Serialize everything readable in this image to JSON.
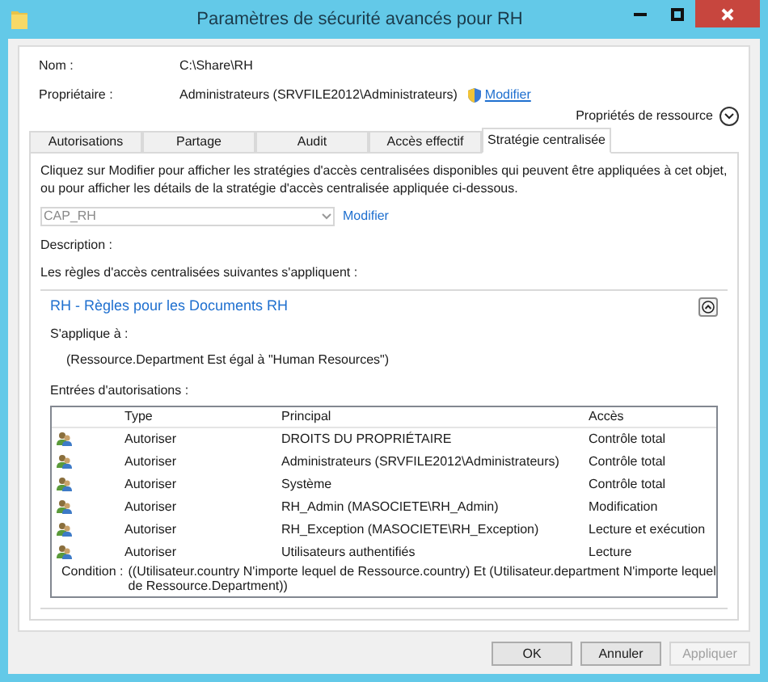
{
  "window": {
    "title": "Paramètres de sécurité avancés pour RH"
  },
  "fields": [
    {
      "label": "Nom :",
      "value": "C:\\Share\\RH"
    },
    {
      "label": "Propriétaire :",
      "value": "Administrateurs (SRVFILE2012\\Administrateurs)",
      "link": "Modifier"
    }
  ],
  "resource_properties": {
    "label": "Propriétés de ressource",
    "expanded": false
  },
  "tabs": [
    {
      "label": "Autorisations",
      "selected": false
    },
    {
      "label": "Partage",
      "selected": false
    },
    {
      "label": "Audit",
      "selected": false
    },
    {
      "label": "Accès effectif",
      "selected": false
    },
    {
      "label": "Stratégie centralisée",
      "selected": true
    }
  ],
  "intro": "Cliquez sur Modifier pour afficher les stratégies d'accès centralisées disponibles qui peuvent être appliquées à cet objet, ou pour afficher les détails de la stratégie d'accès centralisée appliquée ci-dessous.",
  "policy_select": {
    "value": "CAP_RH",
    "disabled": true,
    "link": "Modifier"
  },
  "description_label": "Description :",
  "rules_label": "Les règles d'accès centralisées suivantes s'appliquent :",
  "rule": {
    "title": "RH - Règles pour les Documents RH",
    "expanded": true,
    "applies_label": "S'applique à :",
    "applies": "(Ressource.Department Est égal à \"Human Resources\")",
    "entries_label": "Entrées d'autorisations :",
    "columns": [
      "Type",
      "Principal",
      "Accès"
    ],
    "rows": [
      {
        "type": "Autoriser",
        "principal": "DROITS DU PROPRIÉTAIRE",
        "access": "Contrôle total"
      },
      {
        "type": "Autoriser",
        "principal": "Administrateurs (SRVFILE2012\\Administrateurs)",
        "access": "Contrôle total"
      },
      {
        "type": "Autoriser",
        "principal": "Système",
        "access": "Contrôle total"
      },
      {
        "type": "Autoriser",
        "principal": "RH_Admin (MASOCIETE\\RH_Admin)",
        "access": "Modification"
      },
      {
        "type": "Autoriser",
        "principal": "RH_Exception (MASOCIETE\\RH_Exception)",
        "access": "Lecture et exécution"
      },
      {
        "type": "Autoriser",
        "principal": "Utilisateurs authentifiés",
        "access": "Lecture"
      }
    ],
    "condition_label": "Condition :",
    "condition": "((Utilisateur.country N'importe lequel de Ressource.country) Et (Utilisateur.department N'importe lequel de Ressource.Department))"
  },
  "buttons": [
    {
      "label": "OK",
      "disabled": false
    },
    {
      "label": "Annuler",
      "disabled": false
    },
    {
      "label": "Appliquer",
      "disabled": true
    }
  ]
}
